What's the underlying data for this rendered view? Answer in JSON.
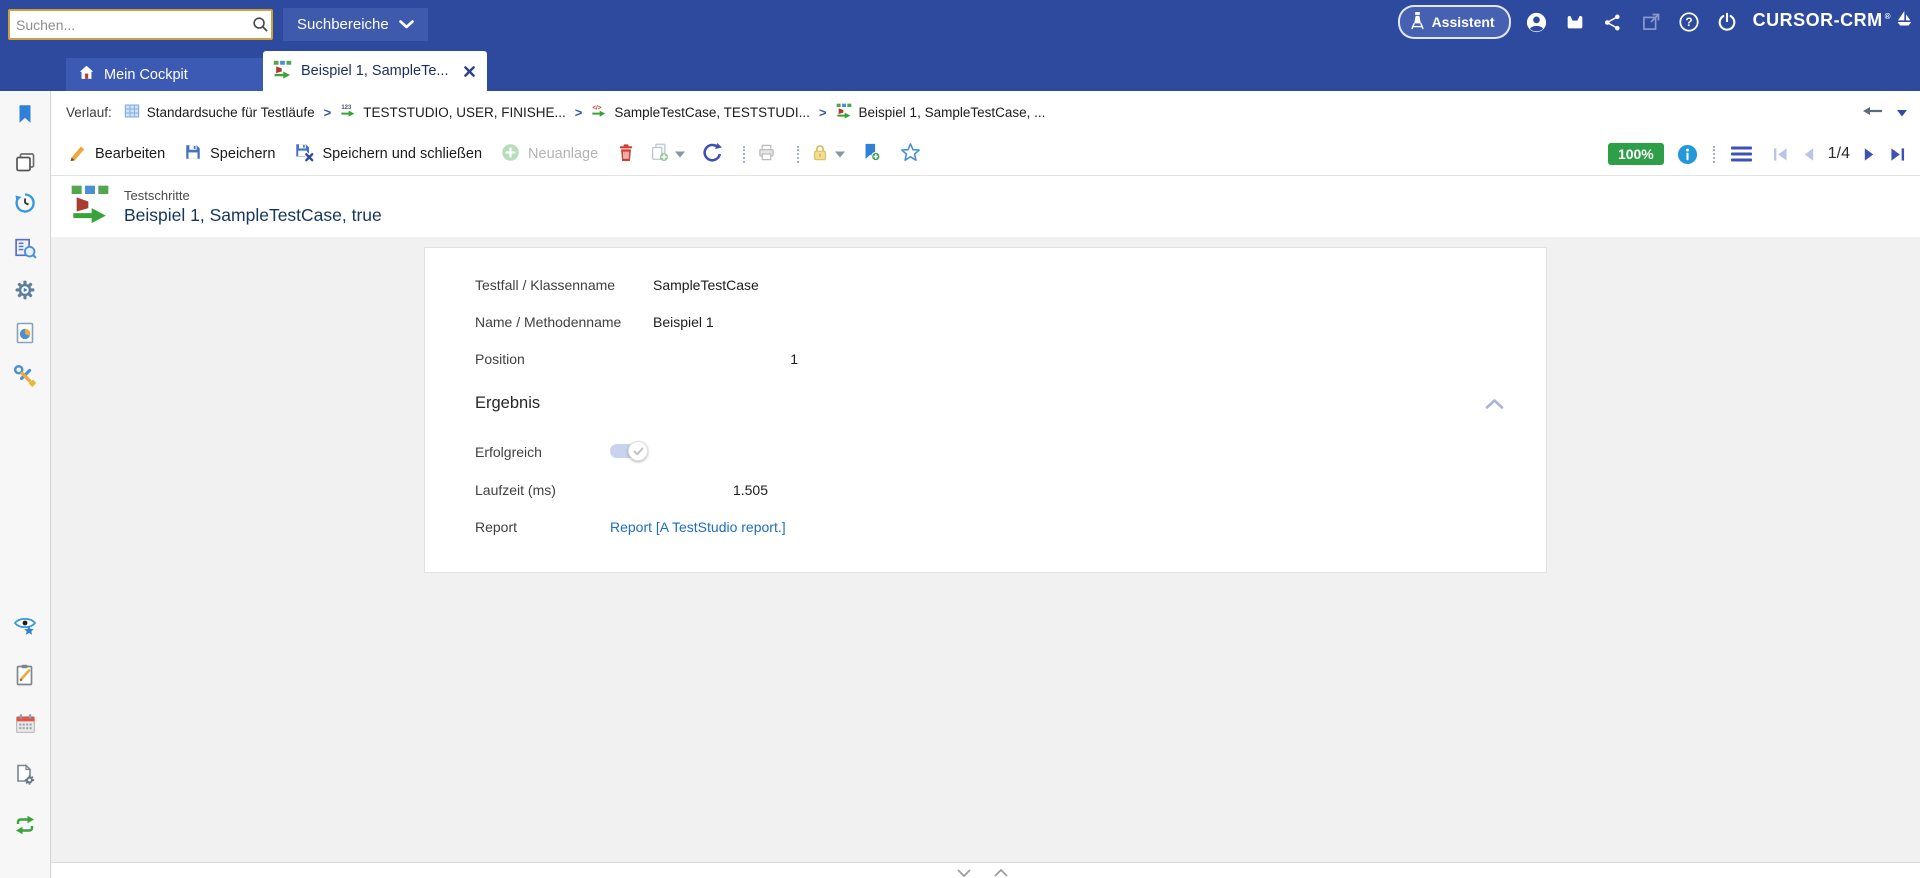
{
  "topbar": {
    "search_placeholder": "Suchen...",
    "scope_button": "Suchbereiche",
    "assistant_button": "Assistent",
    "brand": "CURSOR-CRM",
    "brand_mark": "®"
  },
  "tabs": {
    "cockpit": "Mein Cockpit",
    "record": "Beispiel 1, SampleTe..."
  },
  "breadcrumb": {
    "label": "Verlauf:",
    "separator": ">",
    "items": [
      {
        "label": "Standardsuche für Testläufe",
        "icon": "table-search-icon"
      },
      {
        "label": "TESTSTUDIO, USER, FINISHE...",
        "icon": "testrun-icon"
      },
      {
        "label": "SampleTestCase, TESTSTUDI...",
        "icon": "testcase-icon"
      },
      {
        "label": "Beispiel 1, SampleTestCase, ...",
        "icon": "teststep-icon"
      }
    ]
  },
  "toolbar": {
    "edit": "Bearbeiten",
    "save": "Speichern",
    "save_and_close": "Speichern und schließen",
    "create_new": "Neuanlage",
    "zoom_badge": "100%",
    "page_indicator": "1/4"
  },
  "record_header": {
    "entity": "Testschritte",
    "title": "Beispiel 1, SampleTestCase, true"
  },
  "form": {
    "fields": [
      {
        "label": "Testfall / Klassenname",
        "value": "SampleTestCase"
      },
      {
        "label": "Name / Methodenname",
        "value": "Beispiel 1"
      },
      {
        "label": "Position",
        "value": "1"
      }
    ],
    "result_section": {
      "title": "Ergebnis",
      "success_label": "Erfolgreich",
      "success_state": "on",
      "runtime_label": "Laufzeit (ms)",
      "runtime_value": "1.505",
      "report_label": "Report",
      "report_link": "Report [A TestStudio report.]"
    }
  },
  "icons": {
    "topbar": [
      "search-icon",
      "chevron-down-icon",
      "lighthouse-icon",
      "user-icon",
      "inbox-icon",
      "share-icon",
      "external-link-icon",
      "help-icon",
      "power-icon",
      "sailboat-icon"
    ],
    "toolbar": [
      "pencil-icon",
      "save-icon",
      "save-close-icon",
      "plus-circle-icon",
      "trash-icon",
      "copy-plus-icon",
      "refresh-icon",
      "printer-icon",
      "lock-icon",
      "bookmark-plus-icon",
      "star-icon",
      "info-icon",
      "menu-icon",
      "nav-first-icon",
      "nav-prev-icon",
      "nav-next-icon",
      "nav-last-icon"
    ],
    "sidebar": [
      "bookmark-icon",
      "window-stack-icon",
      "history-icon",
      "search-list-icon",
      "gear-play-icon",
      "report-chart-icon",
      "tools-icon",
      "eye-star-icon",
      "clipboard-edit-icon",
      "calendar-icon",
      "document-gear-icon",
      "sync-arrows-icon"
    ]
  },
  "colors": {
    "topbar_blue": "#2d4a9f",
    "tab_blue": "#3c5ab4",
    "accent_indigo": "#3f51b5",
    "badge_green": "#2f9e49",
    "link_blue": "#1b6ec2",
    "search_border_gold": "#c9a23c"
  }
}
